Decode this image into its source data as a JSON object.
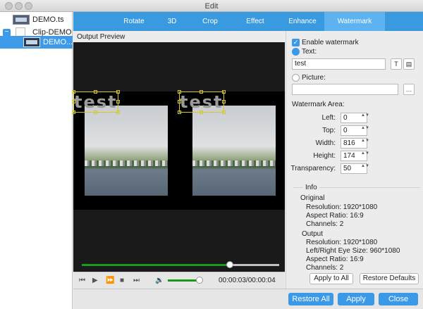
{
  "window": {
    "title": "Edit"
  },
  "sidebar": {
    "items": [
      {
        "label": "DEMO.ts"
      },
      {
        "label": "Clip-DEMO",
        "collapse": "−"
      },
      {
        "label": "DEMO..."
      }
    ]
  },
  "tabs": [
    {
      "label": "Rotate"
    },
    {
      "label": "3D"
    },
    {
      "label": "Crop"
    },
    {
      "label": "Effect"
    },
    {
      "label": "Enhance"
    },
    {
      "label": "Watermark",
      "active": true
    }
  ],
  "preview": {
    "label": "Output Preview",
    "watermark_text": "test",
    "seek_fraction": 0.75
  },
  "player": {
    "timecode": "00:00:03/00:00:04",
    "volume_fraction": 0.9,
    "buttons": {
      "prev": "⏮",
      "play": "▶",
      "forward": "⏩",
      "stop": "■",
      "next": "⏭",
      "volume": "🔉"
    }
  },
  "watermark": {
    "enable_label": "Enable watermark",
    "enable_check": "✓",
    "text_option": "Text:",
    "text_value": "test",
    "text_font_icon": "T",
    "text_color_icon": "▤",
    "picture_option": "Picture:",
    "picture_value": "",
    "browse_icon": "…",
    "area_title": "Watermark Area:",
    "left_label": "Left:",
    "left_value": "0",
    "top_label": "Top:",
    "top_value": "0",
    "width_label": "Width:",
    "width_value": "816",
    "height_label": "Height:",
    "height_value": "174",
    "transparency_label": "Transparency:",
    "transparency_value": "50"
  },
  "info": {
    "title": "Info",
    "original_title": "Original",
    "original_resolution": "Resolution: 1920*1080",
    "original_aspect": "Aspect Ratio: 16:9",
    "original_channels": "Channels: 2",
    "output_title": "Output",
    "output_resolution": "Resolution: 1920*1080",
    "output_eye_size": "Left/Right Eye Size: 960*1080",
    "output_aspect": "Aspect Ratio: 16:9",
    "output_channels": "Channels: 2"
  },
  "actions": {
    "apply_to_all": "Apply to All",
    "restore_defaults": "Restore Defaults",
    "restore_all": "Restore All",
    "apply": "Apply",
    "close": "Close"
  },
  "spin_arrows": "▲▼"
}
